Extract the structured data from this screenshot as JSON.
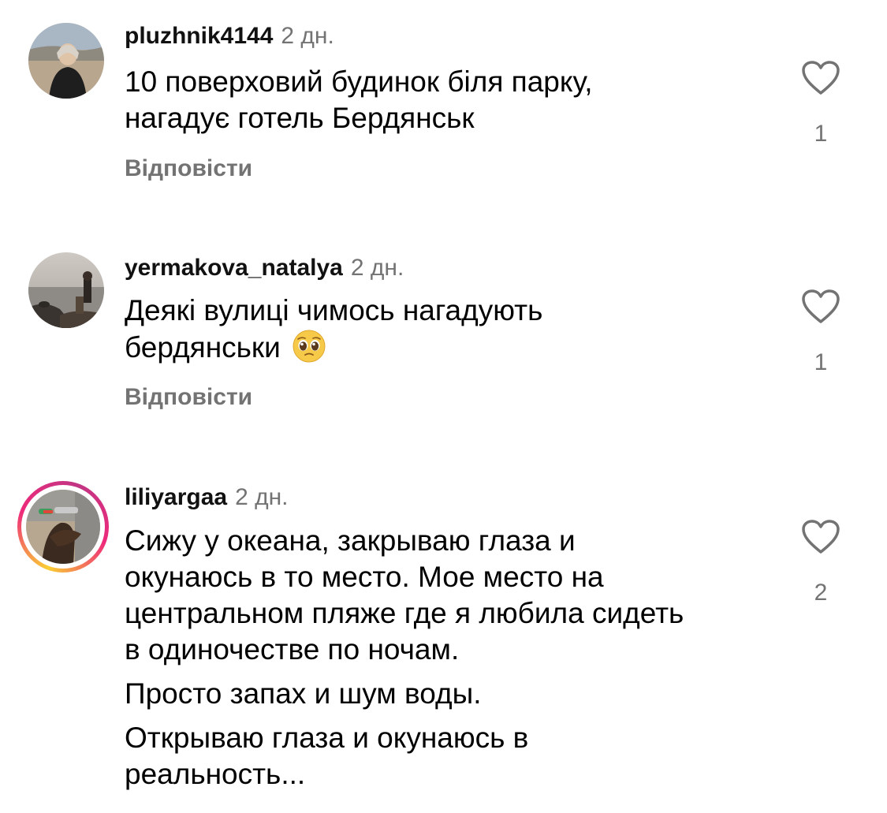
{
  "comments": [
    {
      "username": "pluzhnik4144",
      "time": "2 дн.",
      "text_lines": [
        "10 поверховий будинок біля парку,",
        "нагадує готель Бердянськ"
      ],
      "likes": "1",
      "reply_label": "Відповісти"
    },
    {
      "username": "yermakova_natalya",
      "time": "2 дн.",
      "text_lines": [
        "Деякі вулиці чимось нагадують",
        "бердянськи"
      ],
      "emoji": "pleading-face-emoji",
      "likes": "1",
      "reply_label": "Відповісти"
    },
    {
      "username": "liliyargaa",
      "time": "2 дн.",
      "paragraphs": [
        [
          "Сижу у океана, закрываю глаза и",
          "окунаюсь в то место. Мое место на",
          "центральном пляже где я любила сидеть",
          "в одиночестве по ночам."
        ],
        [
          "Просто запах и шум воды."
        ],
        [
          "Открываю глаза и окунаюсь в",
          "реальность..."
        ]
      ],
      "likes": "2",
      "has_story_ring": true
    }
  ],
  "icons": {
    "like": "heart-outline-icon"
  },
  "colors": {
    "secondary_text": "#737373",
    "story_ring": [
      "#f9ce34",
      "#ee2a7b",
      "#c13584"
    ]
  }
}
